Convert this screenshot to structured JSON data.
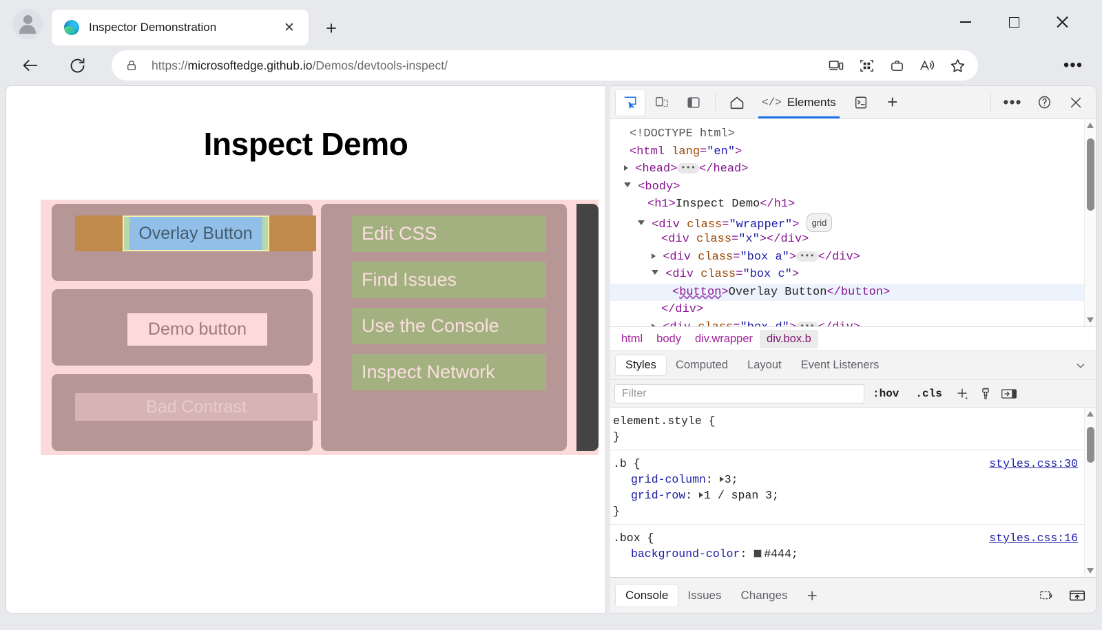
{
  "browser": {
    "tab": {
      "title": "Inspector Demonstration",
      "favicon": "edge-logo-icon",
      "close_label": "✕"
    },
    "new_tab_label": "+",
    "window_controls": {
      "minimize": "minimize-icon",
      "maximize": "maximize-icon",
      "close": "close-icon"
    },
    "address": {
      "url_scheme": "https://",
      "url_host": "microsoftedge.github.io",
      "url_path": "/Demos/devtools-inspect/",
      "lock": "lock-icon"
    },
    "omnibox_icons": [
      "cast-devices-icon",
      "collections-grid-icon",
      "browser-essentials-icon",
      "read-aloud-icon",
      "favorite-star-icon"
    ],
    "more_label": "•••"
  },
  "page": {
    "title": "Inspect Demo",
    "wrapper_bg": "#fcdada",
    "box_bg": "#b79696",
    "overlay": {
      "button_label": "Overlay Button",
      "content_color": "#92bfe8",
      "padding_color": "#b8d8a8",
      "border_color": "#f2f0aa",
      "margin_color": "#c08a4a"
    },
    "demo_button_label": "Demo button",
    "bad_contrast_label": "Bad Contrast",
    "links": [
      "Edit CSS",
      "Find Issues",
      "Use the Console",
      "Inspect Network"
    ],
    "link_bg": "#a3b180",
    "dark_strip_color": "#444"
  },
  "devtools": {
    "toolbar": {
      "inspect_icon": "inspect-element-icon",
      "device_toggle_icon": "device-emulation-icon",
      "dock_icon": "dock-side-icon",
      "home_icon": "home-icon",
      "console_toggle_icon": "console-drawer-icon",
      "add_panel_label": "+",
      "more_label": "•••",
      "help_icon": "help-question-icon",
      "close_icon": "close-icon"
    },
    "panel_tabs": [
      {
        "label": "Elements",
        "icon": "</>",
        "active": true
      }
    ],
    "dom_tree": [
      {
        "indent": 0,
        "tokens": "<!DOCTYPE html>"
      },
      {
        "indent": 0,
        "tokens": "<html lang=\"en\">"
      },
      {
        "indent": 0,
        "tokens": "<head> … </head>"
      },
      {
        "indent": 0,
        "tokens": "<body>"
      },
      {
        "indent": 1,
        "tokens": "<h1>Inspect Demo</h1>"
      },
      {
        "indent": 1,
        "tokens": "<div class=\"wrapper\"> grid"
      },
      {
        "indent": 2,
        "tokens": "<div class=\"x\"></div>"
      },
      {
        "indent": 2,
        "tokens": "<div class=\"box a\"> … </div>"
      },
      {
        "indent": 2,
        "tokens": "<div class=\"box c\">"
      },
      {
        "indent": 3,
        "tokens": "<button>Overlay Button</button>",
        "selected": true
      },
      {
        "indent": 2,
        "tokens": "</div>"
      },
      {
        "indent": 2,
        "tokens": "<div class=\"box d\"> … </div>"
      }
    ],
    "dom_text": {
      "doctype": "<!DOCTYPE html>",
      "html_tag": "html",
      "html_attr_name": "lang",
      "html_attr_value": "\"en\"",
      "head_tag": "head",
      "body_tag": "body",
      "h1_tag": "h1",
      "h1_text": "Inspect Demo",
      "div_tag": "div",
      "class_attr": "class",
      "wrapper_value": "\"wrapper\"",
      "grid_badge": "grid",
      "x_value": "\"x\"",
      "box_a_value": "\"box a\"",
      "box_c_value": "\"box c\"",
      "box_d_value": "\"box d\"",
      "button_tag": "button",
      "button_text": "Overlay Button",
      "ellipsis": "…"
    },
    "breadcrumb": [
      {
        "label": "html",
        "active": false
      },
      {
        "label": "body",
        "active": false
      },
      {
        "label": "div.wrapper",
        "active": false
      },
      {
        "label": "div.box.b",
        "active": true
      }
    ],
    "styles_tabs": [
      {
        "label": "Styles",
        "active": true
      },
      {
        "label": "Computed",
        "active": false
      },
      {
        "label": "Layout",
        "active": false
      },
      {
        "label": "Event Listeners",
        "active": false
      }
    ],
    "styles_filter": {
      "placeholder": "Filter",
      "value": ""
    },
    "styles_tools": {
      "hov": ":hov",
      "cls": ".cls",
      "new_rule": "new-style-rule-icon",
      "color_picker": "color-picker-icon",
      "computed_sidebar": "computed-sidebar-icon"
    },
    "css_rules": [
      {
        "selector": "element.style {",
        "source": "",
        "declarations": [],
        "close": "}"
      },
      {
        "selector": ".b {",
        "source": "styles.css:30",
        "declarations": [
          {
            "prop": "grid-column",
            "value": "3;",
            "expandable": true
          },
          {
            "prop": "grid-row",
            "value": "1 / span 3;",
            "expandable": true
          }
        ],
        "close": "}"
      },
      {
        "selector": ".box {",
        "source": "styles.css:16",
        "declarations": [
          {
            "prop": "background-color",
            "value": "#444;",
            "swatch": "#444444",
            "expandable": false
          }
        ],
        "close": ""
      }
    ],
    "drawer_tabs": [
      {
        "label": "Console",
        "active": true
      },
      {
        "label": "Issues",
        "active": false
      },
      {
        "label": "Changes",
        "active": false
      }
    ],
    "drawer_add_label": "+",
    "drawer_icons": [
      "restore-drawer-icon",
      "move-to-top-icon"
    ]
  }
}
